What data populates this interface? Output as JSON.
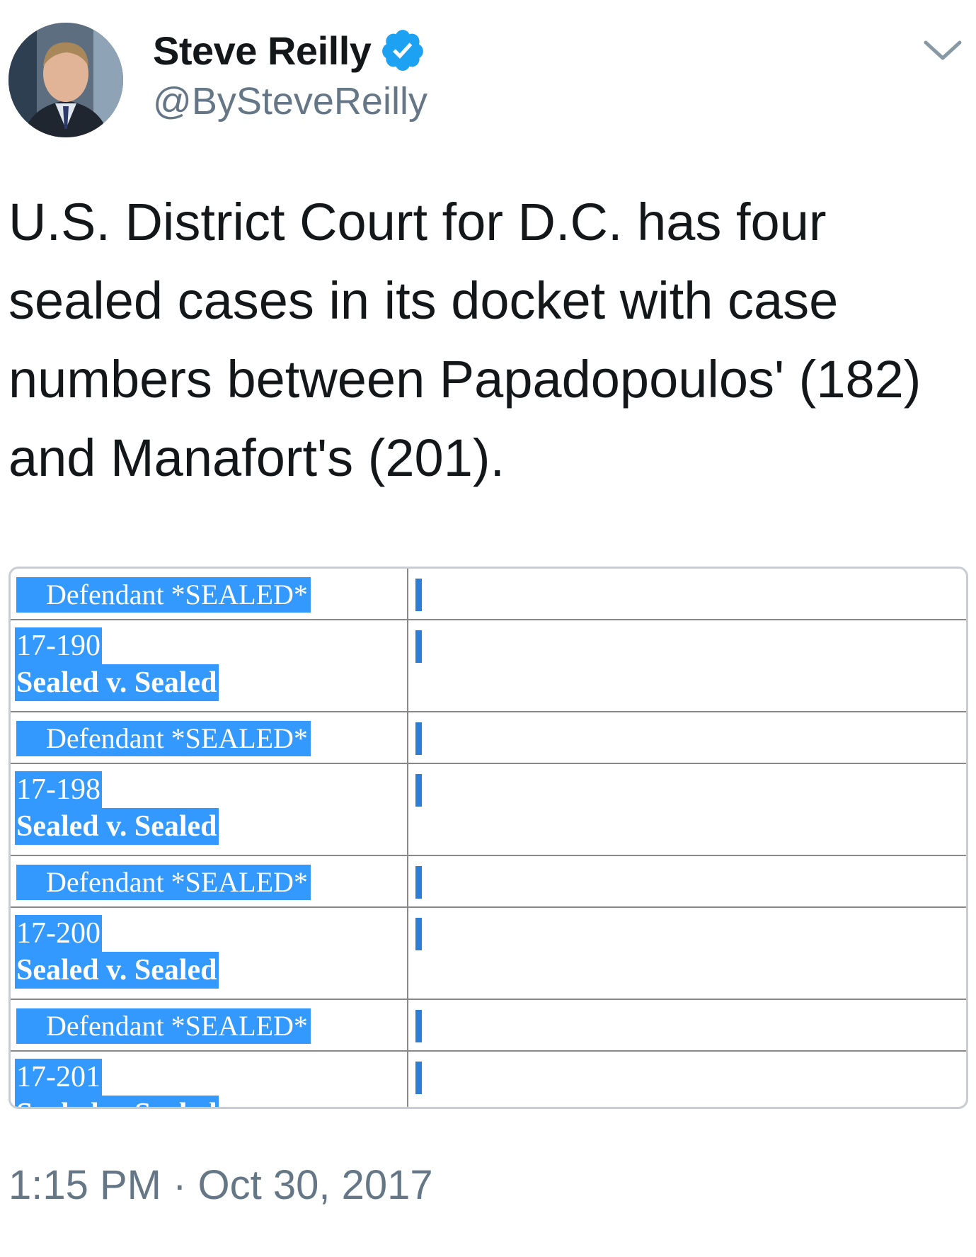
{
  "user": {
    "display_name": "Steve Reilly",
    "handle": "@BySteveReilly",
    "verified": true,
    "avatar_icon": "avatar-photo",
    "verified_icon": "verified-badge-icon",
    "menu_icon": "chevron-down-icon"
  },
  "tweet": {
    "text": "U.S. District Court for D.C. has four sealed cases in its docket with case numbers between Papadopoulos' (182) and Manafort's (201).",
    "timestamp": "1:15 PM · Oct 30, 2017"
  },
  "media": {
    "rows": [
      {
        "defendant": "Defendant *SEALED*",
        "case_number": "17-190",
        "case_title": "Sealed v. Sealed"
      },
      {
        "defendant": "Defendant *SEALED*",
        "case_number": "17-198",
        "case_title": "Sealed v. Sealed"
      },
      {
        "defendant": "Defendant *SEALED*",
        "case_number": "17-200",
        "case_title": "Sealed v. Sealed"
      },
      {
        "defendant": "Defendant *SEALED*",
        "case_number": "17-201",
        "case_title": "Sealed v. Sealed"
      }
    ]
  },
  "colors": {
    "selection": "#3399ff",
    "verified": "#1da1f2",
    "secondary_text": "#657786",
    "primary_text": "#14171a"
  }
}
